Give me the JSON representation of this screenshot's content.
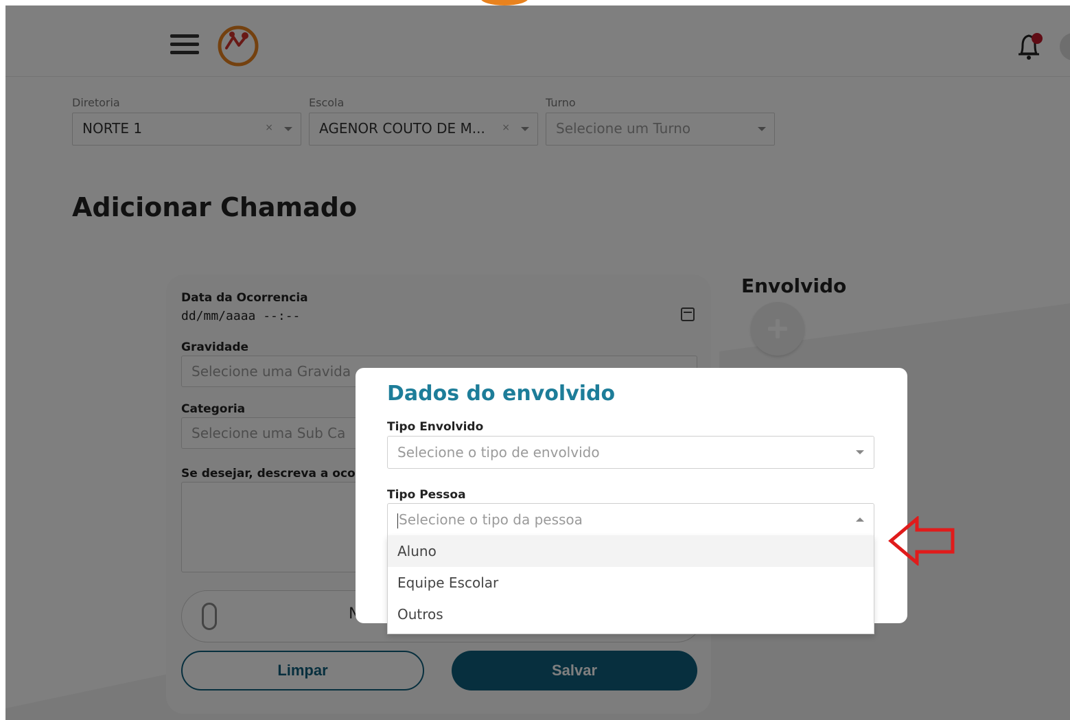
{
  "header": {
    "menu_icon": "hamburger-menu-icon",
    "logo_icon": "app-logo-icon",
    "notification_icon": "bell-icon",
    "notification_count": ""
  },
  "filters": {
    "diretoria": {
      "label": "Diretoria",
      "value": "NORTE 1"
    },
    "escola": {
      "label": "Escola",
      "value": "AGENOR COUTO DE M..."
    },
    "turno": {
      "label": "Turno",
      "placeholder": "Selecione um Turno"
    }
  },
  "page": {
    "title": "Adicionar Chamado"
  },
  "form": {
    "data_label": "Data da Ocorrencia",
    "data_placeholder": "dd/mm/aaaa --:--",
    "gravidade_label": "Gravidade",
    "gravidade_placeholder": "Selecione uma Gravida",
    "categoria_label": "Categoria",
    "categoria_placeholder": "Selecione uma Sub Ca",
    "descricao_label": "Se desejar, descreva a oco",
    "attach_text": "N",
    "limpar_label": "Limpar",
    "salvar_label": "Salvar"
  },
  "envolvido": {
    "title": "Envolvido"
  },
  "modal": {
    "title": "Dados do envolvido",
    "tipo_envolvido_label": "Tipo Envolvido",
    "tipo_envolvido_placeholder": "Selecione o tipo de envolvido",
    "tipo_pessoa_label": "Tipo Pessoa",
    "tipo_pessoa_placeholder": "Selecione o tipo da pessoa",
    "options": [
      "Aluno",
      "Equipe Escolar",
      "Outros"
    ]
  },
  "colors": {
    "primary": "#0e5f7c",
    "modal_title": "#1d7d99",
    "logo_orange": "#e8821e",
    "logo_red": "#d2322d",
    "annotation_red": "#e01b1b"
  }
}
